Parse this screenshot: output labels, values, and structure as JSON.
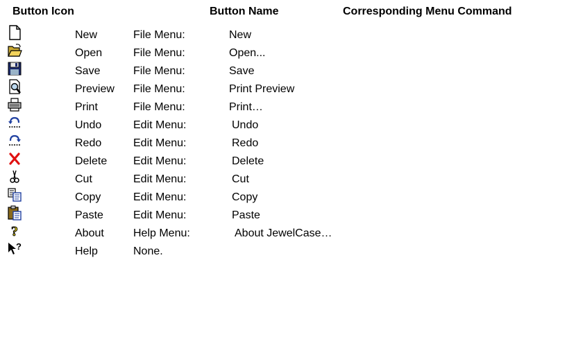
{
  "headers": {
    "icon": "Button Icon",
    "name": "Button Name",
    "command": "Corresponding Menu Command"
  },
  "rows": [
    {
      "icon": "new-document-icon",
      "name": "New",
      "menu": "File Menu:",
      "command": "New"
    },
    {
      "icon": "open-folder-icon",
      "name": "Open",
      "menu": "File Menu:",
      "command": "Open..."
    },
    {
      "icon": "save-disk-icon",
      "name": "Save",
      "menu": "File Menu:",
      "command": "Save"
    },
    {
      "icon": "print-preview-icon",
      "name": "Preview",
      "menu": "File Menu:",
      "command": "Print Preview"
    },
    {
      "icon": "printer-icon",
      "name": "Print",
      "menu": "File Menu:",
      "command": "Print…"
    },
    {
      "icon": "undo-icon",
      "name": "Undo",
      "menu": "Edit Menu:",
      "command": "Undo"
    },
    {
      "icon": "redo-icon",
      "name": "Redo",
      "menu": "Edit Menu:",
      "command": "Redo"
    },
    {
      "icon": "delete-x-icon",
      "name": "Delete",
      "menu": "Edit Menu:",
      "command": "Delete"
    },
    {
      "icon": "scissors-icon",
      "name": "Cut",
      "menu": "Edit Menu:",
      "command": "Cut"
    },
    {
      "icon": "copy-icon",
      "name": "Copy",
      "menu": "Edit Menu:",
      "command": "Copy"
    },
    {
      "icon": "paste-clipboard-icon",
      "name": "Paste",
      "menu": "Edit Menu:",
      "command": "Paste"
    },
    {
      "icon": "question-mark-icon",
      "name": "About",
      "menu": "Help Menu:",
      "command": "About JewelCase…"
    },
    {
      "icon": "context-help-icon",
      "name": "Help",
      "menu": "None.",
      "command": ""
    }
  ]
}
